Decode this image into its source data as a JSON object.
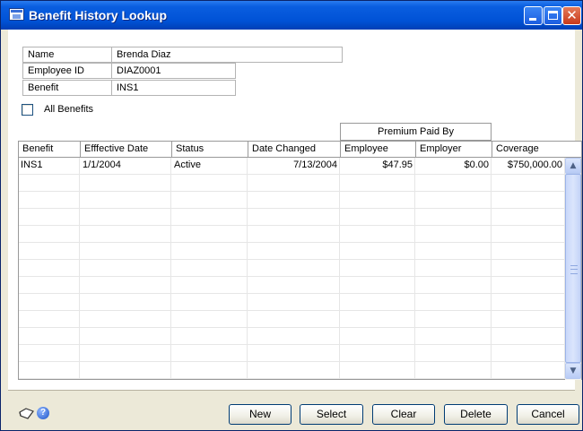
{
  "window": {
    "title": "Benefit History Lookup"
  },
  "fields": {
    "name_label": "Name",
    "name_value": "Brenda  Diaz",
    "employee_id_label": "Employee ID",
    "employee_id_value": "DIAZ0001",
    "benefit_label": "Benefit",
    "benefit_value": "INS1"
  },
  "all_benefits": {
    "label": "All Benefits",
    "checked": false
  },
  "grid": {
    "group_header": "Premium Paid By",
    "columns": [
      "Benefit",
      "Efffective Date",
      "Status",
      "Date Changed",
      "Employee",
      "Employer",
      "Coverage"
    ],
    "rows": [
      [
        "INS1",
        "1/1/2004",
        "Active",
        "7/13/2004",
        "$47.95",
        "$0.00",
        "$750,000.00"
      ]
    ],
    "empty_rows": 12
  },
  "buttons": {
    "new": "New",
    "select": "Select",
    "clear": "Clear",
    "delete": "Delete",
    "cancel": "Cancel"
  },
  "icons": {
    "note": "note-icon",
    "help": "help-icon",
    "window": "window-app-icon"
  },
  "colors": {
    "titlebar": "#0052d6",
    "window_bg": "#ece9d8",
    "grid_line": "#e6e6e6"
  }
}
